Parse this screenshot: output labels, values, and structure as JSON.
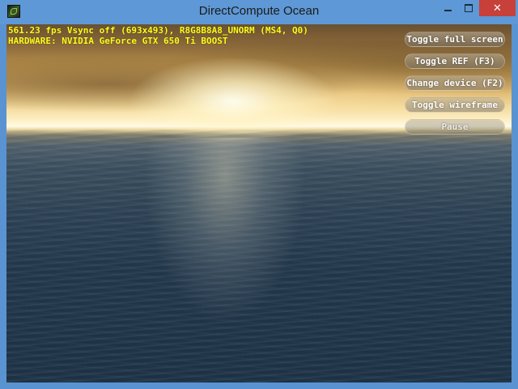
{
  "window": {
    "title": "DirectCompute Ocean",
    "icon": "nvidia-app-icon",
    "controls": {
      "minimize_icon": "minimize-icon",
      "maximize_icon": "maximize-icon",
      "close_label": "✕"
    }
  },
  "hud": {
    "fps_line": "561.23 fps Vsync off (693x493), R8G8B8A8_UNORM (MS4, Q0)",
    "hardware_line": "HARDWARE: NVIDIA GeForce GTX 650 Ti BOOST",
    "color": "#ffff1a"
  },
  "buttons": {
    "toggle_fullscreen": "Toggle full screen",
    "toggle_ref": "Toggle REF (F3)",
    "change_device": "Change device (F2)",
    "toggle_wireframe": "Toggle wireframe",
    "pause": "Pause"
  },
  "colors": {
    "titlebar": "#5e98d6",
    "close_button": "#c7403a",
    "hud_text": "#ffff1a",
    "button_text": "#ffffff"
  }
}
